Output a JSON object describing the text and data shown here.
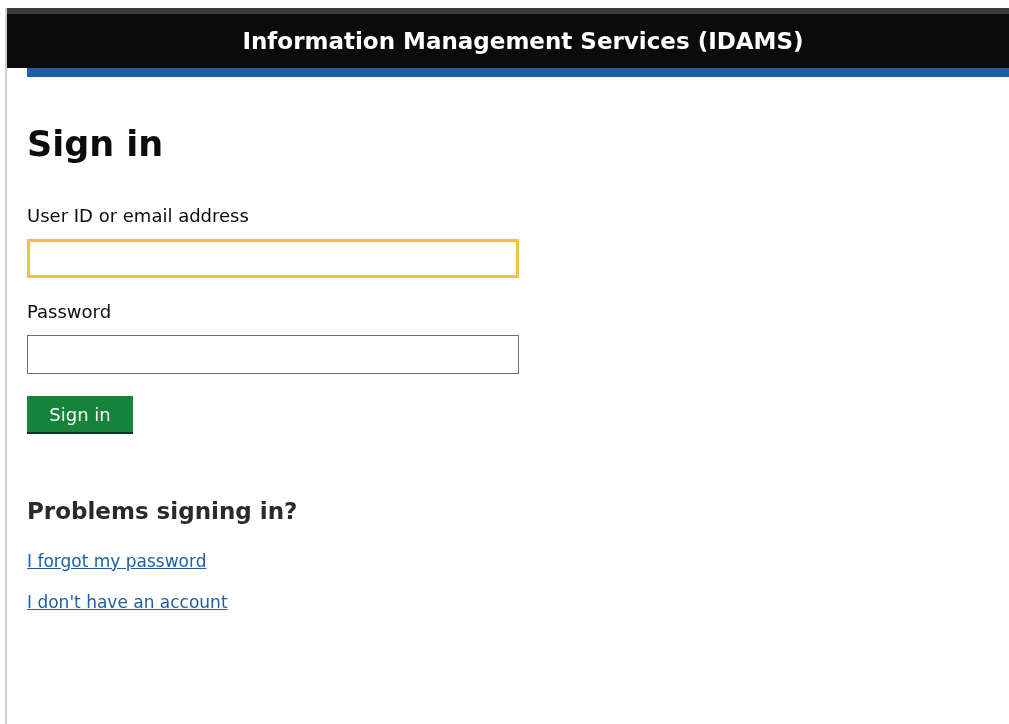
{
  "header": {
    "title": "Information Management Services (IDAMS)"
  },
  "page": {
    "heading": "Sign in"
  },
  "fields": [
    {
      "label": "User ID or email address",
      "focused": true
    },
    {
      "label": "Password",
      "focused": false
    }
  ],
  "submit": {
    "label": "Sign in"
  },
  "help": {
    "heading": "Problems signing in?",
    "links": [
      "I forgot my password",
      "I don't have an account"
    ]
  }
}
